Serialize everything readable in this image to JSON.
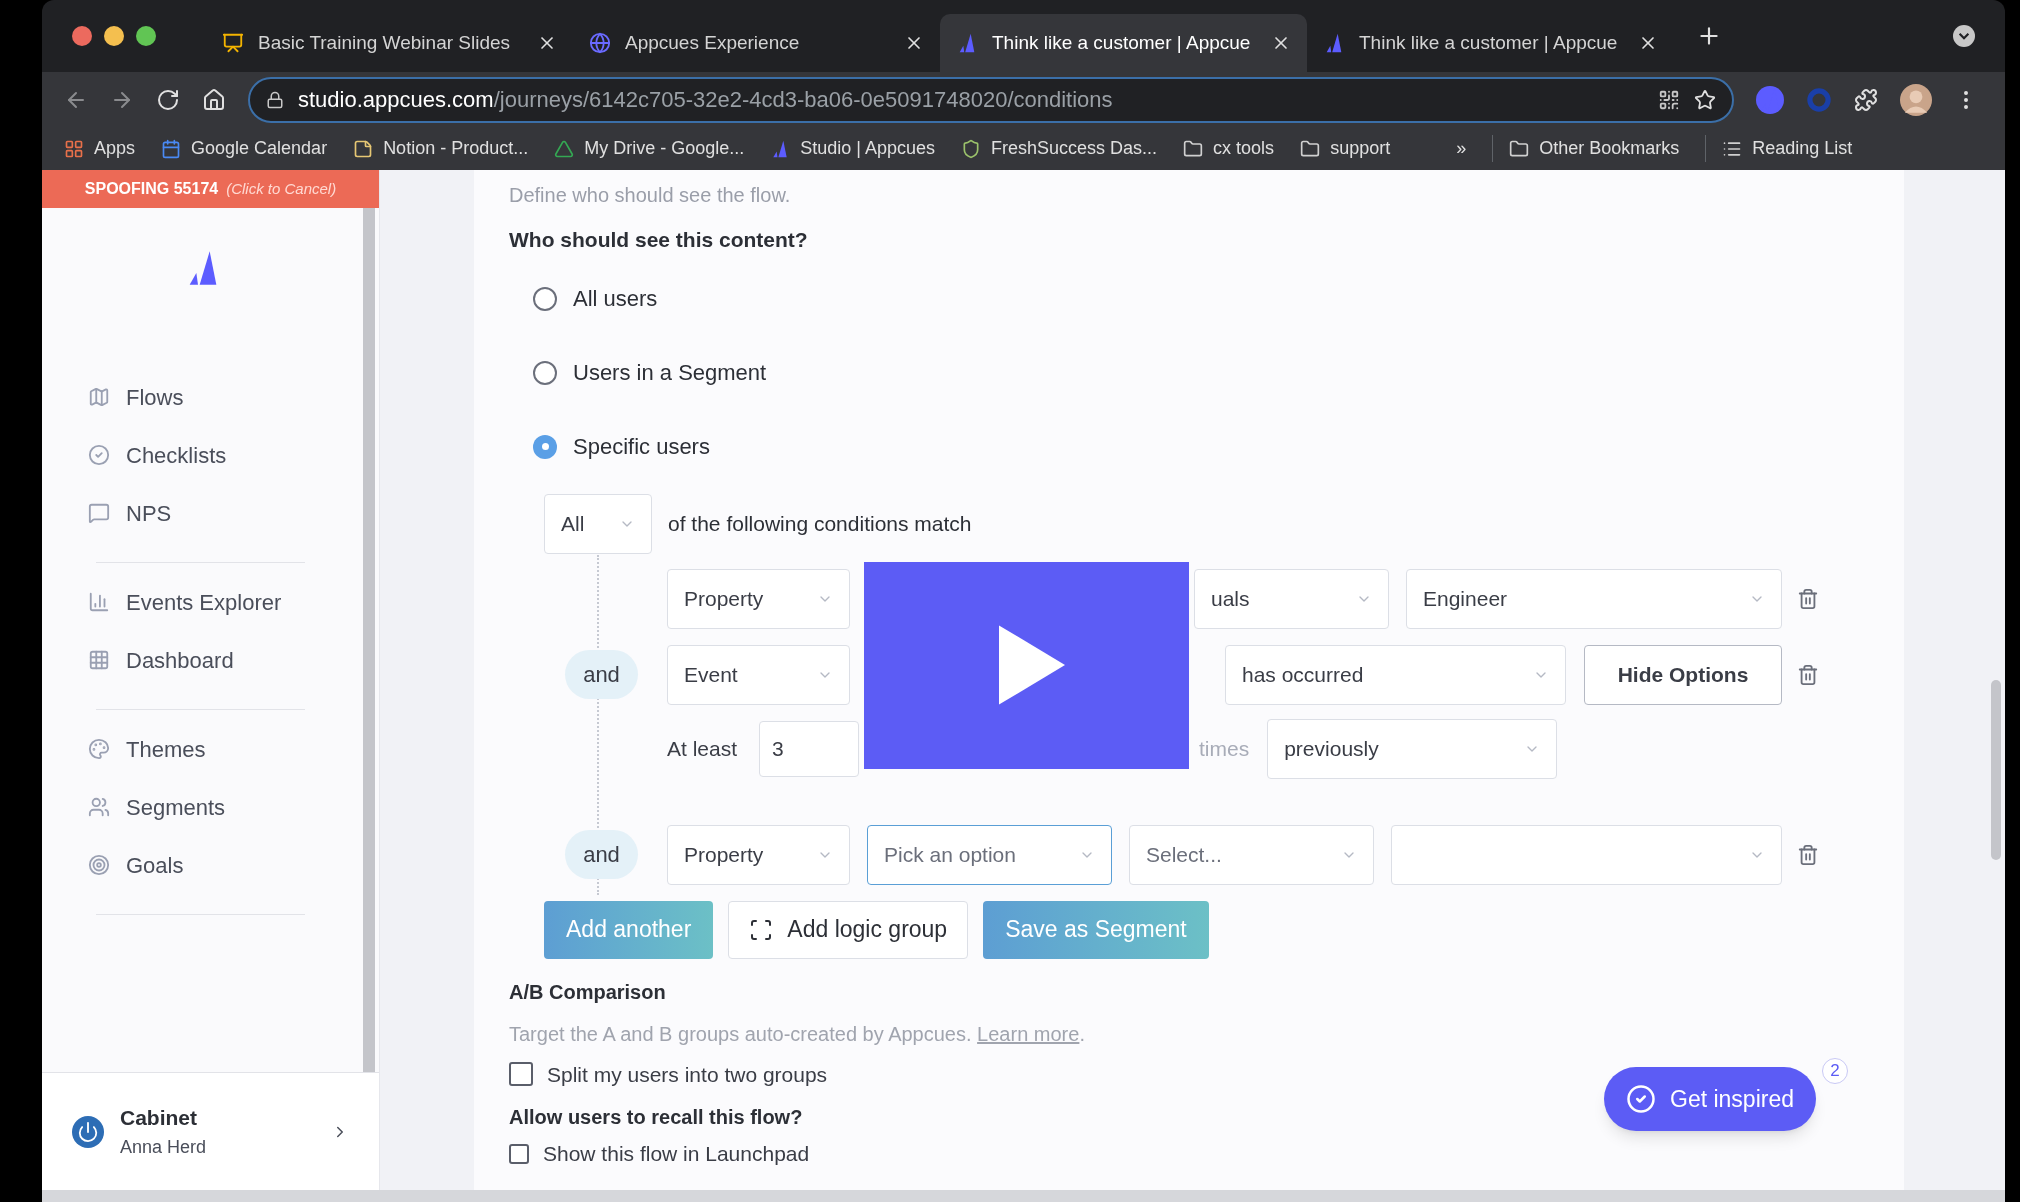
{
  "browser": {
    "tabs": [
      {
        "title": "Basic Training Webinar Slides",
        "kind": "slides",
        "selected": false
      },
      {
        "title": "Appcues Experience",
        "kind": "globe",
        "selected": false
      },
      {
        "title": "Think like a customer | Appcue",
        "kind": "appcues",
        "selected": true
      },
      {
        "title": "Think like a customer | Appcue",
        "kind": "appcues",
        "selected": false
      }
    ],
    "address": {
      "domain": "studio.appcues.com",
      "path": "/journeys/6142c705-32e2-4cd3-ba06-0e5091748020/conditions"
    },
    "bookmarks": [
      {
        "label": "Apps",
        "kind": "apps"
      },
      {
        "label": "Google Calendar",
        "kind": "calendar"
      },
      {
        "label": "Notion - Product...",
        "kind": "note"
      },
      {
        "label": "My Drive - Google...",
        "kind": "drive"
      },
      {
        "label": "Studio | Appcues",
        "kind": "appcues"
      },
      {
        "label": "FreshSuccess Das...",
        "kind": "shield"
      },
      {
        "label": "cx tools",
        "kind": "folder"
      },
      {
        "label": "support",
        "kind": "folder"
      }
    ],
    "overflow": "»",
    "bookmarks_right": [
      {
        "label": "Other Bookmarks",
        "kind": "folder"
      },
      {
        "label": "Reading List",
        "kind": "list"
      }
    ]
  },
  "sidebar": {
    "banner": {
      "label": "SPOOFING 55174",
      "hint": "(Click to Cancel)"
    },
    "groups": [
      [
        {
          "label": "Flows",
          "kind": "map"
        },
        {
          "label": "Checklists",
          "kind": "check"
        },
        {
          "label": "NPS",
          "kind": "chat"
        }
      ],
      [
        {
          "label": "Events Explorer",
          "kind": "chart"
        },
        {
          "label": "Dashboard",
          "kind": "grid"
        }
      ],
      [
        {
          "label": "Themes",
          "kind": "palette"
        },
        {
          "label": "Segments",
          "kind": "users"
        },
        {
          "label": "Goals",
          "kind": "target"
        }
      ]
    ],
    "account": {
      "name": "Cabinet",
      "user": "Anna Herd"
    }
  },
  "main": {
    "intro": "Define who should see the flow.",
    "question": "Who should see this content?",
    "options": [
      {
        "label": "All users",
        "selected": false
      },
      {
        "label": "Users in a Segment",
        "selected": false
      },
      {
        "label": "Specific users",
        "selected": true
      }
    ],
    "match": {
      "quantifier": "All",
      "text": "of the following conditions match"
    },
    "conditions": [
      {
        "kind": "property-set",
        "type": "Property",
        "operator": "uals",
        "value": "Engineer"
      },
      {
        "kind": "event",
        "connector": "and",
        "type": "Event",
        "operator": "has occurred",
        "action": "Hide Options",
        "frequency": {
          "label": "At least",
          "count": "3",
          "unit": "times",
          "when": "previously"
        }
      },
      {
        "kind": "property-new",
        "connector": "and",
        "type": "Property",
        "name": "Pick an option",
        "name_focused": true,
        "operator": "Select..."
      }
    ],
    "buttons": [
      {
        "label": "Add another",
        "kind": "primary"
      },
      {
        "label": "Add logic group",
        "kind": "group"
      },
      {
        "label": "Save as Segment",
        "kind": "primary"
      }
    ],
    "ab": {
      "title": "A/B Comparison",
      "desc": "Target the A and B groups auto-created by Appcues.",
      "link": "Learn more",
      "after": ".",
      "checkbox": {
        "label": "Split my users into two groups",
        "checked": false
      }
    },
    "recall": {
      "title": "Allow users to recall this flow?",
      "checkbox": {
        "label": "Show this flow in Launchpad",
        "checked": false
      }
    },
    "inspire": {
      "label": "Get inspired",
      "badge": "2"
    }
  }
}
